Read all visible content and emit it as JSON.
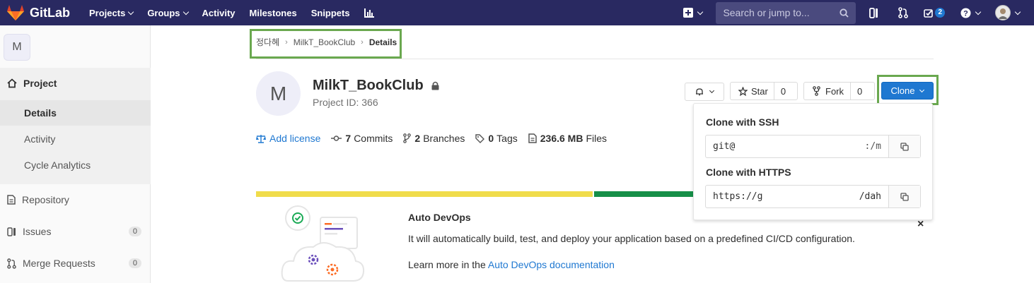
{
  "navbar": {
    "brand": "GitLab",
    "links": [
      "Projects",
      "Groups",
      "Activity",
      "Milestones",
      "Snippets"
    ],
    "search_placeholder": "Search or jump to...",
    "todo_count": "2"
  },
  "sidebar": {
    "avatar_letter": "M",
    "project_label": "Project",
    "project_sub": [
      "Details",
      "Activity",
      "Cycle Analytics"
    ],
    "items": [
      {
        "label": "Repository",
        "count": ""
      },
      {
        "label": "Issues",
        "count": "0"
      },
      {
        "label": "Merge Requests",
        "count": "0"
      }
    ]
  },
  "breadcrumb": [
    "정다혜",
    "MilkT_BookClub",
    "Details"
  ],
  "project": {
    "avatar_letter": "M",
    "name": "MilkT_BookClub",
    "id_text": "Project ID: 366"
  },
  "stats": {
    "license": "Add license",
    "commits_count": "7",
    "commits_label": "Commits",
    "branches_count": "2",
    "branches_label": "Branches",
    "tags_count": "0",
    "tags_label": "Tags",
    "files_size": "236.6 MB",
    "files_label": "Files"
  },
  "actions": {
    "star_label": "Star",
    "star_count": "0",
    "fork_label": "Fork",
    "fork_count": "0",
    "clone_label": "Clone"
  },
  "clone_dropdown": {
    "ssh_label": "Clone with SSH",
    "ssh_value_start": "git@",
    "ssh_value_end": ":/m",
    "https_label": "Clone with HTTPS",
    "https_value_start": "https://g",
    "https_value_end": "/dah"
  },
  "auto_devops": {
    "title": "Auto DevOps",
    "text": "It will automatically build, test, and deploy your application based on a predefined CI/CD configuration.",
    "learn_prefix": "Learn more in the",
    "learn_link": "Auto DevOps documentation",
    "close": "×"
  },
  "colors": {
    "navbar": "#292961",
    "accent": "#1f78d1",
    "progress_yellow": "#f0dc4b",
    "progress_green": "#1aaa55",
    "highlight": "#6aa84f"
  },
  "icons": [
    "gitlab-logo-icon",
    "chart-icon",
    "plus-icon",
    "search-icon",
    "sidebar-toggle-icon",
    "merge-request-icon",
    "todo-icon",
    "help-icon",
    "home-icon",
    "lock-icon",
    "bell-icon",
    "star-icon",
    "fork-icon",
    "scale-icon",
    "commit-icon",
    "branch-icon",
    "tag-icon",
    "file-icon",
    "copy-icon",
    "close-icon"
  ]
}
